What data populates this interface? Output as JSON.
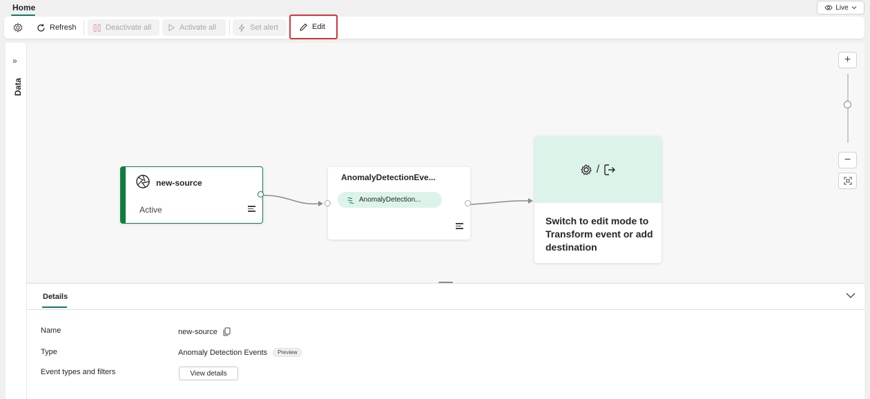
{
  "header": {
    "tab_home": "Home",
    "live_label": "Live"
  },
  "toolbar": {
    "refresh": "Refresh",
    "deactivate_all": "Deactivate all",
    "activate_all": "Activate all",
    "set_alert": "Set alert",
    "edit": "Edit"
  },
  "side_panel": {
    "label": "Data"
  },
  "canvas": {
    "source_node": {
      "title": "new-source",
      "status": "Active"
    },
    "event_node": {
      "title": "AnomalyDetectionEve...",
      "pill_label": "AnomalyDetection..."
    },
    "destination_node": {
      "separator": "/",
      "message": "Switch to edit mode to Transform event or add destination"
    }
  },
  "details": {
    "tab": "Details",
    "rows": [
      {
        "label": "Name",
        "value": "new-source"
      },
      {
        "label": "Type",
        "value": "Anomaly Detection Events",
        "badge": "Preview"
      },
      {
        "label": "Event types and filters",
        "button": "View details"
      }
    ]
  },
  "colors": {
    "accent": "#117865",
    "source_active": "#107c41",
    "highlight": "#d13438",
    "pill_bg": "#dcf3ea"
  }
}
